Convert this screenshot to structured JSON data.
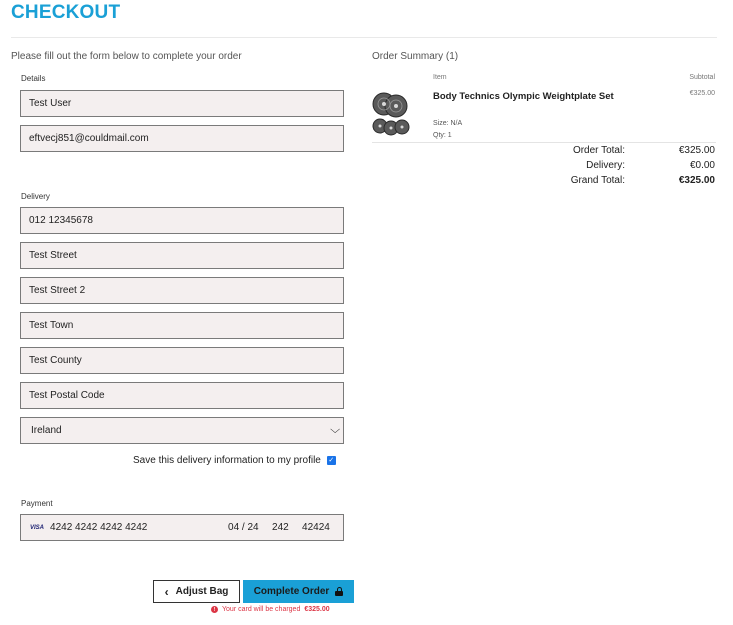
{
  "page": {
    "title": "CHECKOUT"
  },
  "form": {
    "intro": "Please fill out the form below to complete your order",
    "details_label": "Details",
    "full_name": "Test User",
    "email": "eftvecj851@couldmail.com",
    "delivery_label": "Delivery",
    "phone": "012 12345678",
    "street1": "Test Street",
    "street2": "Test Street 2",
    "town": "Test Town",
    "county": "Test County",
    "postcode": "Test Postal Code",
    "country": "Ireland",
    "save_info_label": "Save this delivery information to my profile",
    "save_info_checked": true,
    "payment_label": "Payment",
    "card_brand": "VISA",
    "card_number": "4242 4242 4242 4242",
    "card_expiry": "04 / 24",
    "card_cvc": "242",
    "card_postal": "42424"
  },
  "actions": {
    "adjust_label": "Adjust Bag",
    "complete_label": "Complete Order",
    "charge_note": "Your card will be charged",
    "charge_amount": "€325.00"
  },
  "summary": {
    "title": "Order Summary (1)",
    "col_item": "Item",
    "col_subtotal": "Subtotal",
    "product": {
      "name": "Body Technics Olympic Weightplate Set",
      "size": "Size: N/A",
      "qty": "Qty: 1",
      "subtotal": "€325.00"
    },
    "order_total_label": "Order Total:",
    "order_total": "€325.00",
    "delivery_label": "Delivery:",
    "delivery": "€0.00",
    "grand_total_label": "Grand Total:",
    "grand_total": "€325.00"
  },
  "colors": {
    "accent": "#1aa0d6",
    "error": "#dc3545",
    "field_bg": "#f4efef"
  }
}
